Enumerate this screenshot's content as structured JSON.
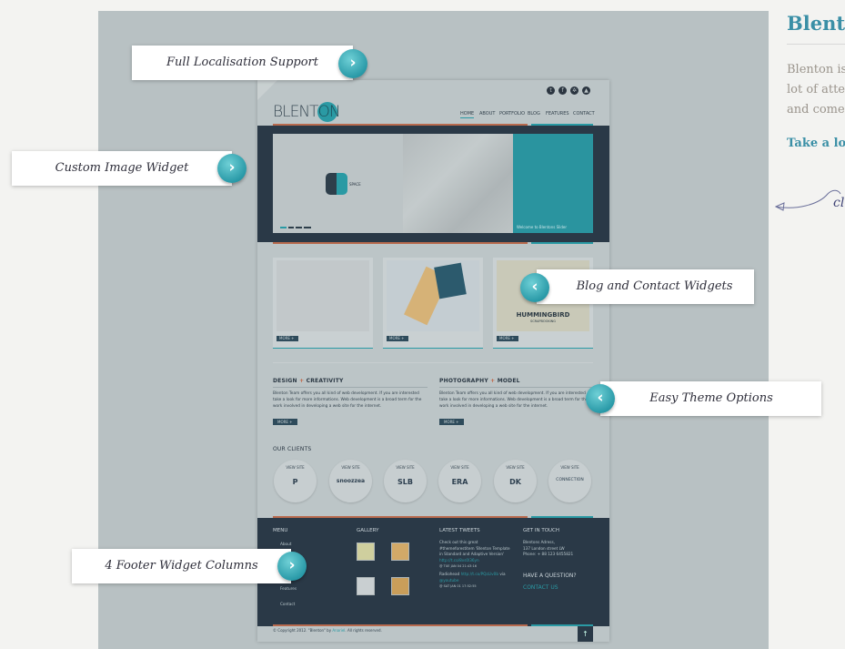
{
  "preview": {
    "logo": {
      "text": "BLENT",
      "accent": "ON"
    },
    "social_icons": [
      "twitter-icon",
      "facebook-icon",
      "dribbble-icon",
      "forrst-icon"
    ],
    "nav": [
      "HOME",
      "ABOUT",
      "PORTFOLIO",
      "BLOG",
      "FEATURES",
      "CONTACT"
    ],
    "slider": {
      "badge": "SPACE",
      "caption": "Welcome to Blentons Slider"
    },
    "cards": [
      {
        "more": "MORE +"
      },
      {
        "more": "MORE +"
      },
      {
        "more": "MORE +",
        "title": "HUMMINGBIRD",
        "subtitle": "SCRAPBOOKING"
      }
    ],
    "columns": [
      {
        "title_a": "DESIGN",
        "title_b": "CREATIVITY",
        "text": "Blenton Team offers you all kind of web development. If you are interested take a look for more informations. Web development is a broad term for the work involved in developing a web site for the internet.",
        "more": "MORE +"
      },
      {
        "title_a": "PHOTOGRAPHY",
        "title_b": "MODEL",
        "text": "Blenton Team offers you all kind of web development. If you are interested take a look for more informations. Web development is a broad term for the work involved in developing a web site for the internet.",
        "more": "MORE +"
      }
    ],
    "clients": {
      "title": "OUR CLIENTS",
      "view": "VIEW SITE",
      "logos": [
        "P",
        "snoozzea",
        "SLB",
        "ERA",
        "DK",
        "CONNECTION"
      ]
    },
    "footer": {
      "menu_title": "MENU",
      "menu": [
        "About",
        "Features",
        "Contact"
      ],
      "gallery_title": "GALLERY",
      "tweets_title": "LATEST TWEETS",
      "tweet1": "Check out this great #themeforestitem 'Blenton Template in Standard and Adaptive Version'",
      "tweet1_link": "http://t.co/8vs0l36yn",
      "tweet1_date": "@ TUE JAN 04 21:43:16",
      "tweet2": "Radiohead",
      "tweet2_link": "http://t.co/PQzLlv0b",
      "tweet2_via": "via",
      "tweet2_user": "@youtube",
      "tweet2_date": "@ SAT JAN 01 17:52:55",
      "touch_title": "GET IN TOUCH",
      "address1": "Blentons Adress,",
      "address2": "137 London street LW",
      "phone": "Phone: + 88 123 6455821",
      "question": "HAVE A QUESTION?",
      "contact": "CONTACT US"
    },
    "copyright": "© Copyright 2012. \"Blenton\" by",
    "author": "Anariel",
    "rights": ". All rights reserved."
  },
  "callouts": [
    "Full Localisation Support",
    "Custom Image Widget",
    "Blog and Contact Widgets",
    "Easy Theme Options",
    "4 Footer Widget Columns"
  ],
  "side": {
    "title": "Blenton",
    "lines": [
      "Blenton is",
      "lot of atten",
      "and comes"
    ],
    "link": "Take a loo",
    "hand": "cli"
  },
  "colors": {
    "accent": "#2a9aa4",
    "dark": "#2a3947",
    "orange": "#b86a4e",
    "title": "#3a8fa6"
  }
}
